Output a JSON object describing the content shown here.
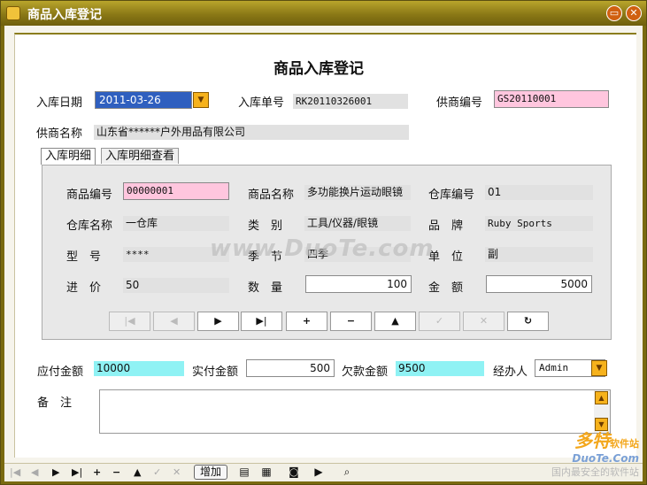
{
  "window": {
    "title": "商品入库登记"
  },
  "form": {
    "heading": "商品入库登记",
    "in_date_label": "入库日期",
    "in_date_value": "2011-03-26",
    "in_no_label": "入库单号",
    "in_no_value": "RK20110326001",
    "supplier_code_label": "供商编号",
    "supplier_code_value": "GS20110001",
    "supplier_name_label": "供商名称",
    "supplier_name_value": "山东省******户外用品有限公司"
  },
  "tabs": [
    {
      "label": "入库明细",
      "active": true
    },
    {
      "label": "入库明细查看",
      "active": false
    }
  ],
  "detail": {
    "product_code_label": "商品编号",
    "product_code_value": "00000001",
    "product_name_label": "商品名称",
    "product_name_value": "多功能换片运动眼镜",
    "warehouse_code_label": "仓库编号",
    "warehouse_code_value": "01",
    "warehouse_name_label": "仓库名称",
    "warehouse_name_value": "一仓库",
    "category_label": "类　别",
    "category_value": "工具/仪器/眼镜",
    "brand_label": "品　牌",
    "brand_value": "Ruby Sports",
    "model_label": "型　号",
    "model_value": "****",
    "season_label": "季　节",
    "season_value": "四季",
    "unit_label": "单　位",
    "unit_value": "副",
    "price_label": "进　价",
    "price_value": "50",
    "qty_label": "数　量",
    "qty_value": "100",
    "amount_label": "金　额",
    "amount_value": "5000"
  },
  "nav": [
    "|◀",
    "◀",
    "▶",
    "▶|",
    "+",
    "−",
    "▲",
    "✓",
    "✕",
    "↻"
  ],
  "footer": {
    "payable_label": "应付金额",
    "payable_value": "10000",
    "paid_label": "实付金额",
    "paid_value": "500",
    "owed_label": "欠款金额",
    "owed_value": "9500",
    "handler_label": "经办人",
    "handler_value": "Admin",
    "remark_label": "备　注"
  },
  "watermark": "www.DuoTe.com",
  "toolbar": {
    "add_label": "增加"
  },
  "brand": {
    "big": "多特",
    "sub": "软件站",
    "site": "DuoTe.Com",
    "slogan": "国内最安全的软件站"
  },
  "colors": {
    "titlebar": "#8a7816",
    "required": "#ffc6de",
    "total": "#8ff2f4",
    "dropdown": "#f6b21c"
  },
  "icons": {
    "app": "box-icon",
    "minimize": "minimize-icon",
    "close": "close-icon",
    "calendar": "calendar-dropdown-icon"
  }
}
